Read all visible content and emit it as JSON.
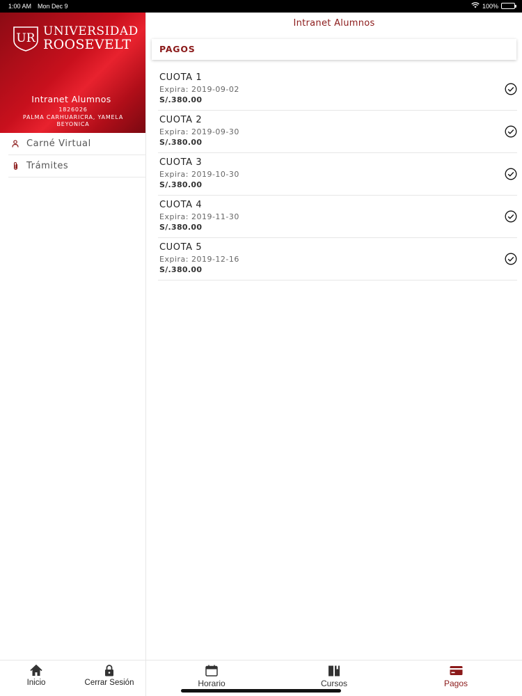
{
  "status": {
    "time": "1:00 AM",
    "date": "Mon Dec 9",
    "battery": "100%"
  },
  "brand": {
    "initials": "UR",
    "line1": "UNIVERSIDAD",
    "line2": "ROOSEVELT"
  },
  "profile": {
    "app_title": "Intranet Alumnos",
    "code": "1826026",
    "name": "PALMA CARHUARICRA, YAMELA BEYONICA"
  },
  "menu": [
    {
      "label": "Carné Virtual",
      "icon": "person-icon"
    },
    {
      "label": "Trámites",
      "icon": "paperclip-icon"
    }
  ],
  "sidebar_tabs": [
    {
      "label": "Inicio",
      "icon": "home-icon"
    },
    {
      "label": "Cerrar Sesión",
      "icon": "lock-icon"
    }
  ],
  "header": {
    "title": "Intranet Alumnos"
  },
  "section": {
    "title": "PAGOS"
  },
  "payments": [
    {
      "title": "CUOTA 1",
      "expires": "Expira: 2019-09-02",
      "amount": "S/.380.00",
      "paid": true
    },
    {
      "title": "CUOTA 2",
      "expires": "Expira: 2019-09-30",
      "amount": "S/.380.00",
      "paid": true
    },
    {
      "title": "CUOTA 3",
      "expires": "Expira: 2019-10-30",
      "amount": "S/.380.00",
      "paid": true
    },
    {
      "title": "CUOTA 4",
      "expires": "Expira: 2019-11-30",
      "amount": "S/.380.00",
      "paid": true
    },
    {
      "title": "CUOTA 5",
      "expires": "Expira: 2019-12-16",
      "amount": "S/.380.00",
      "paid": true
    }
  ],
  "tabs": [
    {
      "label": "Horario",
      "icon": "calendar-icon",
      "active": false
    },
    {
      "label": "Cursos",
      "icon": "book-icon",
      "active": false
    },
    {
      "label": "Pagos",
      "icon": "credit-card-icon",
      "active": true
    }
  ],
  "colors": {
    "brand": "#c8101d",
    "accent": "#8b1a1a",
    "divider": "#e6e6e6"
  }
}
